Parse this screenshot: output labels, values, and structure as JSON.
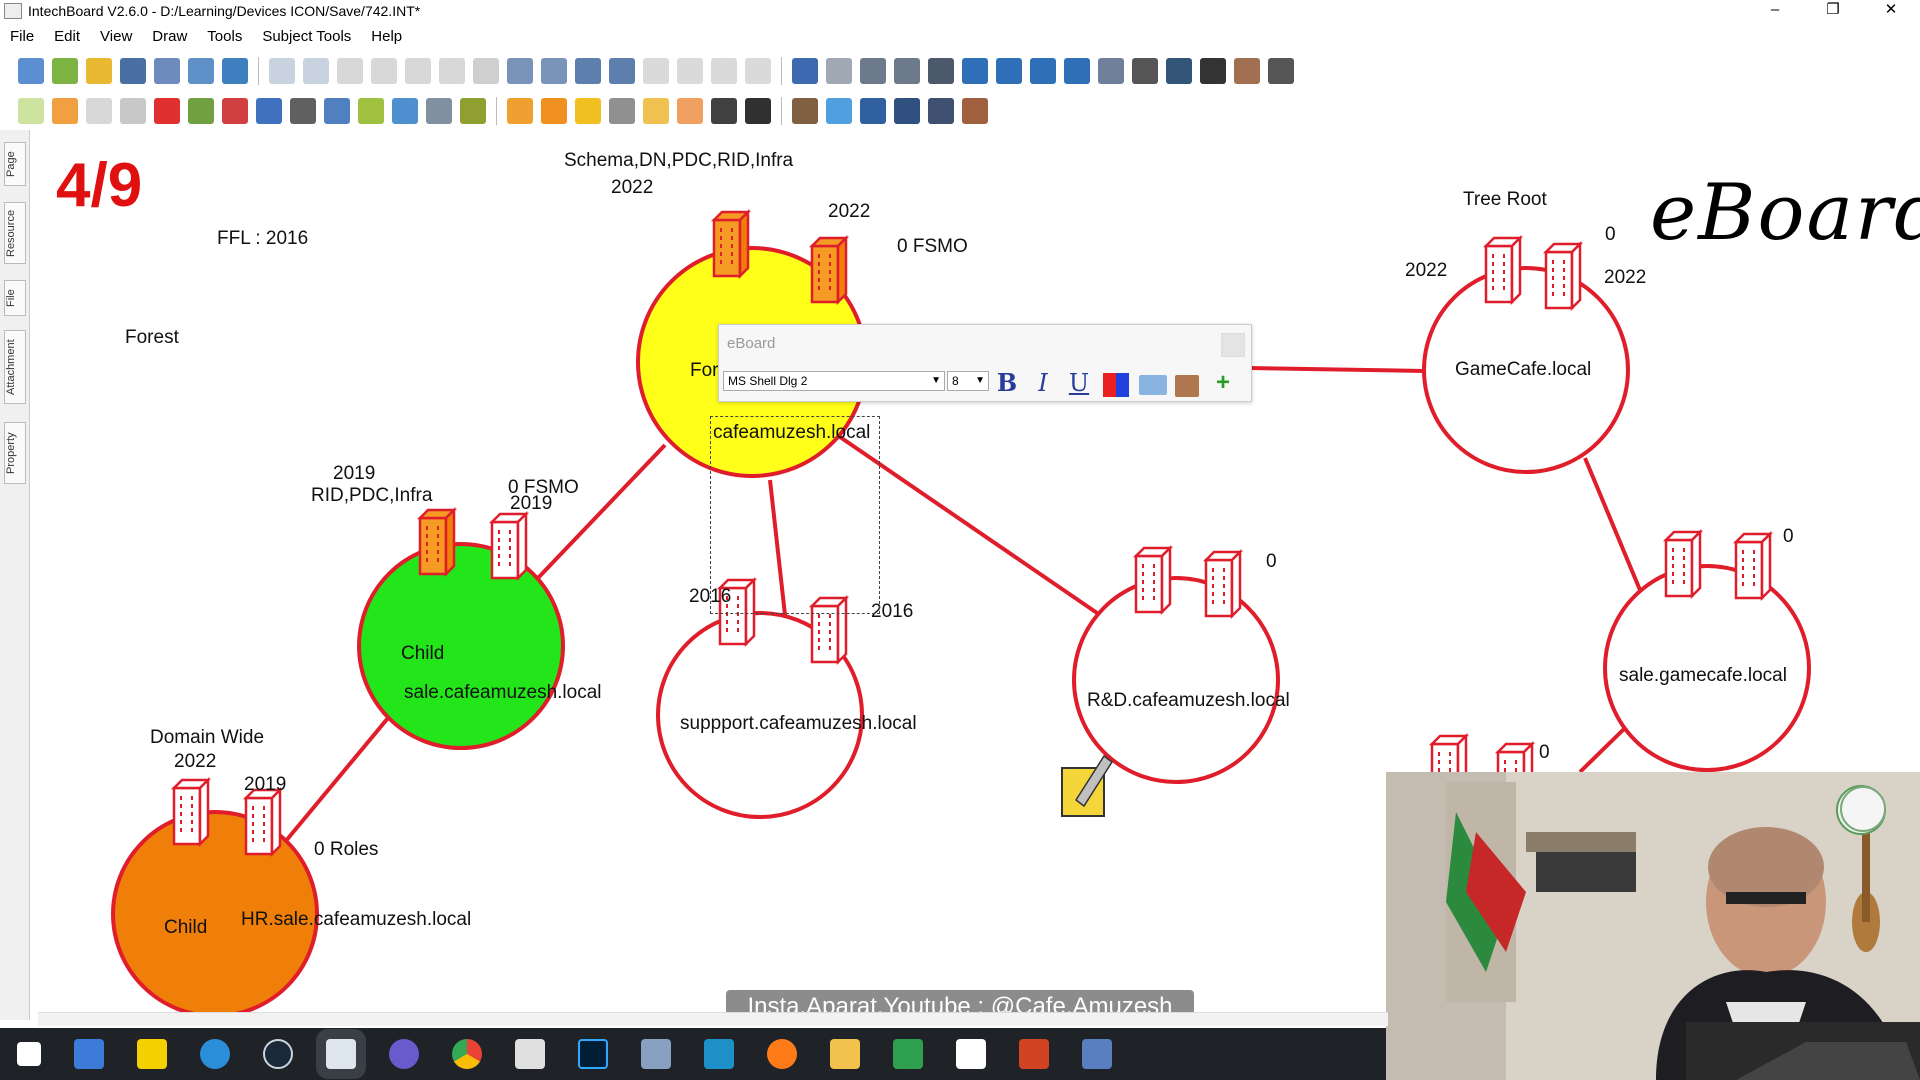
{
  "window": {
    "title": "IntechBoard V2.6.0 - D:/Learning/Devices ICON/Save/742.INT*",
    "controls": {
      "minimize": "–",
      "restore": "❐",
      "close": "✕"
    }
  },
  "menu": [
    "File",
    "Edit",
    "View",
    "Draw",
    "Tools",
    "Subject Tools",
    "Help"
  ],
  "side_tabs": [
    "Page",
    "Resource",
    "File",
    "Attachment",
    "Property"
  ],
  "board": {
    "page_counter": "4/9",
    "logo_text": "eBoard",
    "labels": {
      "ffl": "FFL : 2016",
      "forest": "Forest",
      "forest_roles": "Schema,DN,PDC,RID,Infra",
      "forest_root_year": "2022",
      "forest_dc2_year": "2022",
      "forest_fsmo": "0 FSMO",
      "tree_root": "Tree Root",
      "gamecafe_dc1_year": "2022",
      "gamecafe_zero": "0",
      "gamecafe_dc2_year": "2022",
      "child_year": "2019",
      "child_roles": "RID,PDC,Infra",
      "child_fsmo": "0 FSMO",
      "child_dc2_year": "2019",
      "support_dc1_year": "2016",
      "support_dc2_year": "2016",
      "rd_zero": "0",
      "salegame_zero": "0",
      "hidden_zero": "0",
      "domain_wide": "Domain Wide",
      "hr_year": "2022",
      "hr_dc2_year": "2019",
      "hr_roles": "0 Roles"
    },
    "domains": {
      "forest_root": {
        "name": "cafeamuzesh.local",
        "prefix": "For",
        "color": "#ffff1a"
      },
      "gamecafe": {
        "name": "GameCafe.local",
        "color": "#ffffff"
      },
      "child_sale": {
        "type": "Child",
        "name": "sale.cafeamuzesh.local",
        "color": "#22e61a"
      },
      "support": {
        "name": "suppport.cafeamuzesh.local",
        "color": "#ffffff"
      },
      "rd": {
        "name": "R&D.cafeamuzesh.local",
        "color": "#ffffff"
      },
      "sale_game": {
        "name": "sale.gamecafe.local",
        "color": "#ffffff"
      },
      "hr": {
        "type": "Child",
        "name": "HR.sale.cafeamuzesh.local",
        "color": "#f07f0a"
      }
    },
    "accent_red": "#e01e2b"
  },
  "text_editor": {
    "title": "eBoard",
    "font": "MS Shell Dlg 2",
    "size": "8",
    "bold": "B",
    "italic": "I",
    "underline": "U",
    "add": "+"
  },
  "watermark": "Insta,Aparat,Youtube : @Cafe.Amuzesh",
  "taskbar_icons": [
    "windows-start-icon",
    "network-icon",
    "notes-icon",
    "browser-icon",
    "steam-icon",
    "intechboard-icon",
    "capture-icon",
    "chrome-icon",
    "game-icon",
    "photoshop-icon",
    "connect-icon",
    "window-icon",
    "firefox-icon",
    "folder-icon",
    "camtasia-icon",
    "c-icon",
    "powerpoint-icon",
    "server-icon"
  ]
}
